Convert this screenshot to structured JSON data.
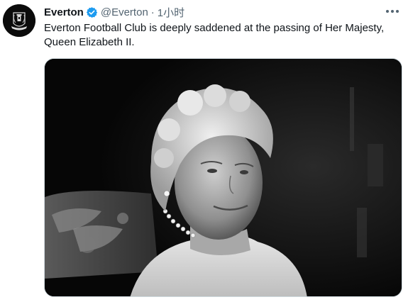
{
  "tweet": {
    "author": {
      "display_name": "Everton",
      "handle": "@Everton",
      "verified": true
    },
    "separator": "·",
    "time": "1小时",
    "text": "Everton Football Club is deeply saddened at the passing of Her Majesty, Queen Elizabeth II.",
    "media": {
      "type": "photo",
      "style": "black-and-white portrait"
    }
  },
  "colors": {
    "text_primary": "#0f1419",
    "text_secondary": "#536471",
    "verified_blue": "#1d9bf0",
    "avatar_bg": "#0b0b0b"
  },
  "icons": {
    "avatar": "everton-crest-icon",
    "verified": "verified-badge-icon",
    "more": "more-options-icon"
  }
}
